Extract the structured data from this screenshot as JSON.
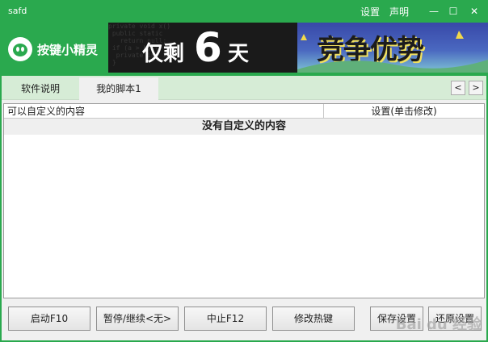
{
  "window": {
    "title": "safd",
    "links": {
      "settings": "设置",
      "statement": "声明"
    },
    "controls": {
      "minimize": "—",
      "maximize": "☐",
      "close": "✕"
    }
  },
  "logo": {
    "text": "按键小精灵"
  },
  "ad1": {
    "left": "仅剩",
    "big": "6",
    "right": "天"
  },
  "ad2": {
    "text": "竞争优势"
  },
  "tabs": [
    {
      "label": "软件说明",
      "active": false
    },
    {
      "label": "我的脚本1",
      "active": true
    }
  ],
  "tab_nav": {
    "prev": "<",
    "next": ">"
  },
  "table": {
    "columns": [
      "可以自定义的内容",
      "设置(单击修改)"
    ],
    "empty_text": "没有自定义的内容"
  },
  "buttons": {
    "start": "启动F10",
    "pause": "暂停/继续<无>",
    "stop": "中止F12",
    "hotkey": "修改热键",
    "save": "保存设置",
    "restore": "还原设置"
  },
  "watermark": "Bai du 经验",
  "colors": {
    "titlebar": "#2aa94e",
    "tabbar": "#d6ecd6",
    "client": "#f0f0f0"
  }
}
